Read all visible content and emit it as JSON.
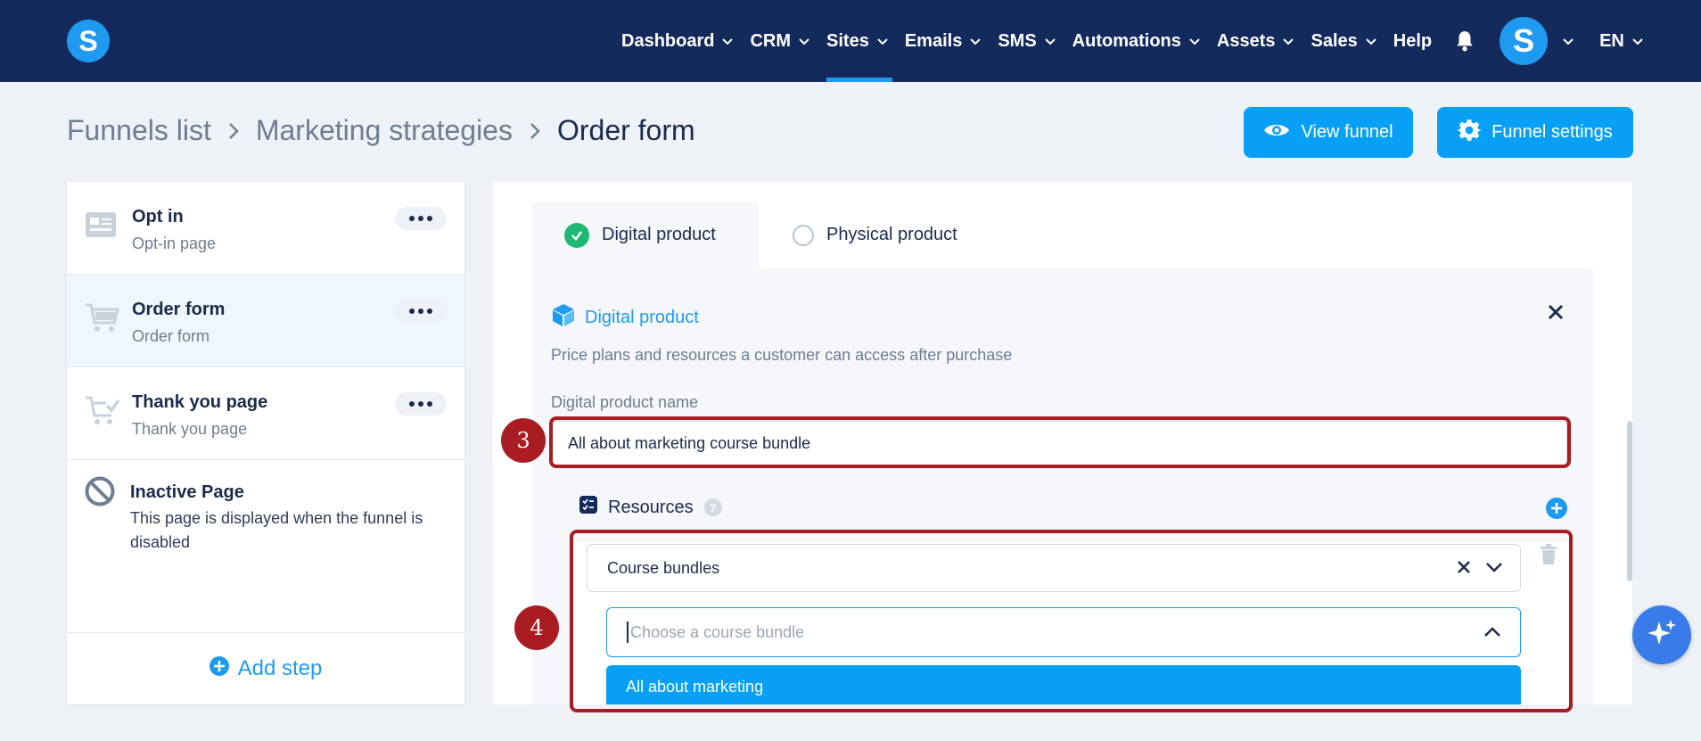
{
  "nav": {
    "items": [
      {
        "label": "Dashboard",
        "dropdown": true,
        "active": false
      },
      {
        "label": "CRM",
        "dropdown": true,
        "active": false
      },
      {
        "label": "Sites",
        "dropdown": true,
        "active": true
      },
      {
        "label": "Emails",
        "dropdown": true,
        "active": false
      },
      {
        "label": "SMS",
        "dropdown": true,
        "active": false
      },
      {
        "label": "Automations",
        "dropdown": true,
        "active": false
      },
      {
        "label": "Assets",
        "dropdown": true,
        "active": false
      },
      {
        "label": "Sales",
        "dropdown": true,
        "active": false
      },
      {
        "label": "Help",
        "dropdown": false,
        "active": false
      }
    ],
    "logo_letter": "S",
    "avatar_letter": "S",
    "language": "EN"
  },
  "breadcrumb": {
    "items": [
      "Funnels list",
      "Marketing strategies"
    ],
    "current": "Order form"
  },
  "actions": {
    "view_funnel": "View funnel",
    "funnel_settings": "Funnel settings"
  },
  "steps": [
    {
      "title": "Opt in",
      "subtitle": "Opt-in page",
      "icon": "opt-in-page-icon"
    },
    {
      "title": "Order form",
      "subtitle": "Order form",
      "icon": "cart-icon"
    },
    {
      "title": "Thank you page",
      "subtitle": "Thank you page",
      "icon": "cart-check-icon"
    }
  ],
  "inactive": {
    "title": "Inactive Page",
    "description": "This page is displayed when the funnel is disabled"
  },
  "add_step": "Add step",
  "tabs": {
    "digital": "Digital product",
    "physical": "Physical product"
  },
  "product": {
    "heading": "Digital product",
    "description": "Price plans and resources a customer can access after purchase",
    "name_label": "Digital product name",
    "name_value": "All about marketing course bundle"
  },
  "resources": {
    "heading": "Resources",
    "help": "?",
    "type_value": "Course bundles",
    "bundle_placeholder": "Choose a course bundle",
    "option": "All about marketing"
  },
  "annotations": {
    "badge_3": "3",
    "badge_4": "4"
  },
  "colors": {
    "nav_bg": "#142a5c",
    "accent": "#08a0f7",
    "annotation": "#a81c22",
    "success": "#1db974"
  }
}
